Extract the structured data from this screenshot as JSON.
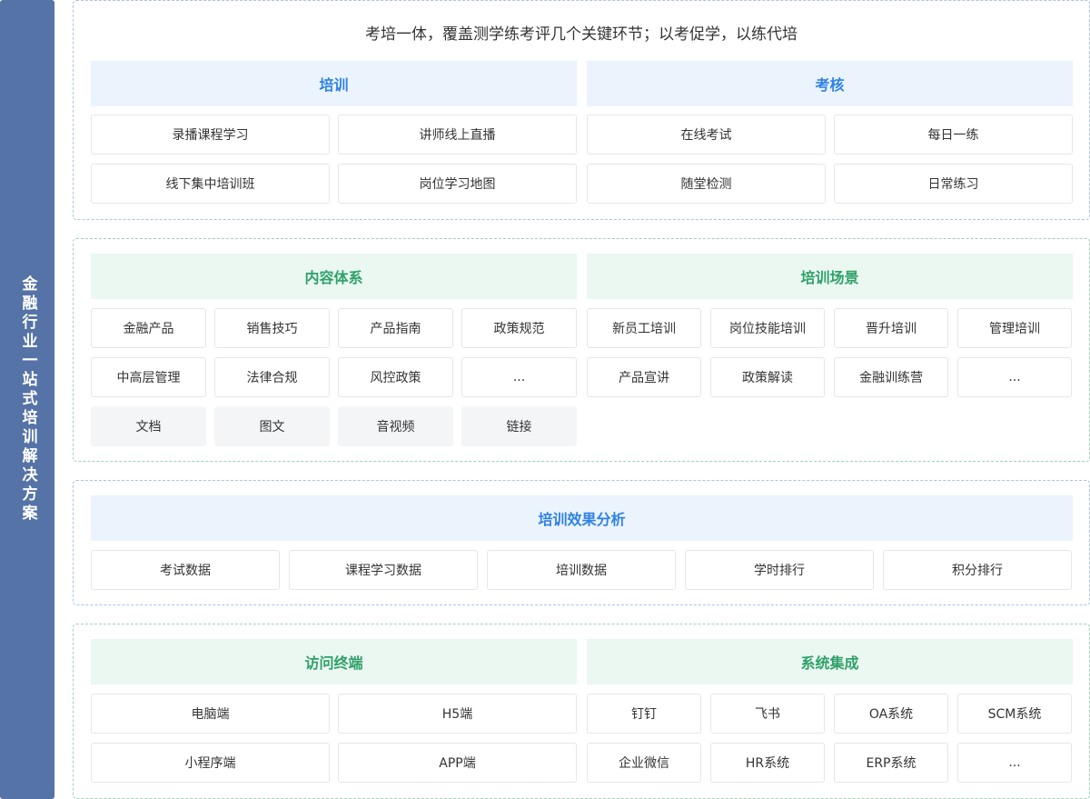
{
  "sidebar": {
    "title": "金融行业一站式培训解决方案"
  },
  "section1": {
    "slogan": "考培一体，覆盖测学练考评几个关键环节；以考促学，以练代培",
    "training": {
      "title": "培训",
      "items": [
        "录播课程学习",
        "讲师线上直播",
        "线下集中培训班",
        "岗位学习地图"
      ]
    },
    "assessment": {
      "title": "考核",
      "items": [
        "在线考试",
        "每日一练",
        "随堂检测",
        "日常练习"
      ]
    }
  },
  "section2": {
    "content": {
      "title": "内容体系",
      "items": [
        "金融产品",
        "销售技巧",
        "产品指南",
        "政策规范",
        "中高层管理",
        "法律合规",
        "风控政策",
        "..."
      ],
      "formats": [
        "文档",
        "图文",
        "音视频",
        "链接"
      ]
    },
    "scenes": {
      "title": "培训场景",
      "items": [
        "新员工培训",
        "岗位技能培训",
        "晋升培训",
        "管理培训",
        "产品宣讲",
        "政策解读",
        "金融训练营",
        "..."
      ]
    }
  },
  "section3": {
    "analysis": {
      "title": "培训效果分析",
      "items": [
        "考试数据",
        "课程学习数据",
        "培训数据",
        "学时排行",
        "积分排行"
      ]
    }
  },
  "section4": {
    "terminals": {
      "title": "访问终端",
      "items": [
        "电脑端",
        "H5端",
        "小程序端",
        "APP端"
      ]
    },
    "integration": {
      "title": "系统集成",
      "items": [
        "钉钉",
        "飞书",
        "OA系统",
        "SCM系统",
        "企业微信",
        "HR系统",
        "ERP系统",
        "..."
      ]
    }
  },
  "colors": {
    "sidebar": "#5573a6",
    "blue_header_bg": "#ebf3fd",
    "blue_header_text": "#2f82e6",
    "green_header_bg": "#ebf7f1",
    "green_header_text": "#2fa16a"
  }
}
